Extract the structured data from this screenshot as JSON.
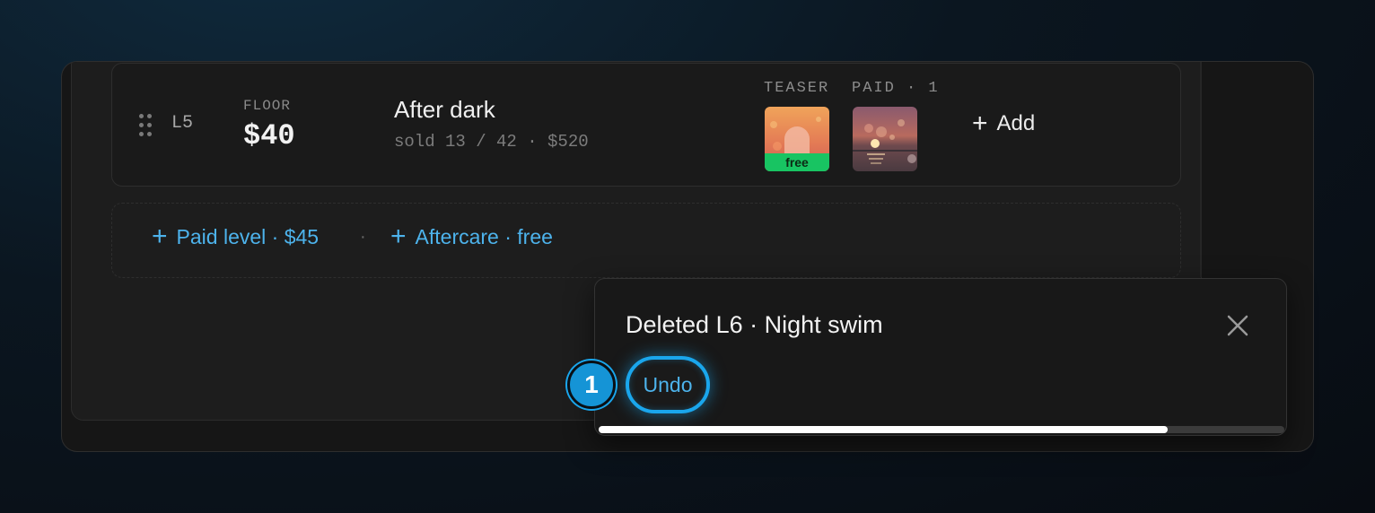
{
  "level": {
    "id": "L5",
    "floor_label": "FLOOR",
    "floor_price": "$40",
    "title": "After dark",
    "subtitle": "sold 13 / 42 · $520",
    "teaser_label": "TEASER",
    "paid_label": "PAID · 1",
    "free_badge": "free",
    "add_label": "Add",
    "thumbnails": [
      {
        "name": "teaser-thumbnail",
        "icon": "sunset-arch"
      },
      {
        "name": "paid-thumbnail",
        "icon": "sunset-bokeh"
      }
    ]
  },
  "quick_add": {
    "paid_level": "Paid level · $45",
    "separator": "·",
    "aftercare": "Aftercare · free"
  },
  "toast": {
    "message": "Deleted L6 · Night swim",
    "undo_label": "Undo",
    "progress": 0.83
  },
  "step_badge": "1",
  "colors": {
    "accent": "#1aa6ec",
    "link": "#4db3ec",
    "free_badge": "#18c462",
    "background": "#161616"
  }
}
